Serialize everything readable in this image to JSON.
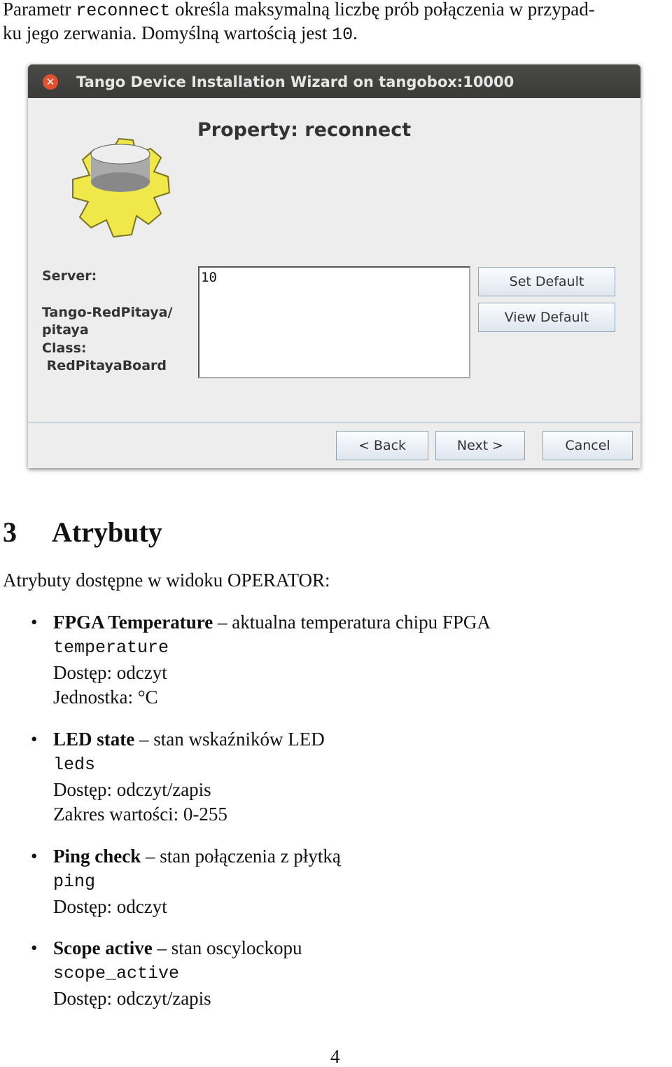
{
  "intro": {
    "line1_a": "Parametr ",
    "line1_code": "reconnect",
    "line1_b": " określa maksymalną liczbę prób połączenia w przypad-",
    "line2_a": "ku jego zerwania. Domyślną wartością jest ",
    "line2_code": "10",
    "line2_b": "."
  },
  "window": {
    "title": "Tango Device Installation Wizard on tangobox:10000",
    "property_title": "Property: reconnect",
    "server_label": "Server:",
    "server_value1": "Tango-RedPitaya/",
    "server_value2": "pitaya",
    "class_label": "Class:",
    "class_value": " RedPitayaBoard",
    "value": "10",
    "set_default": "Set Default",
    "view_default": "View Default",
    "back": "< Back",
    "next": "Next >",
    "cancel": "Cancel"
  },
  "section": {
    "number": "3",
    "title": "Atrybuty",
    "intro": "Atrybuty dostępne w widoku OPERATOR:"
  },
  "items": [
    {
      "name": "FPGA Temperature",
      "desc": " – aktualna temperatura chipu FPGA",
      "code": "temperature",
      "lines": [
        "Dostęp: odczyt",
        "Jednostka: °C"
      ]
    },
    {
      "name": "LED state",
      "desc": " – stan wskaźników LED",
      "code": "leds",
      "lines": [
        "Dostęp: odczyt/zapis",
        "Zakres wartości: 0-255"
      ]
    },
    {
      "name": "Ping check",
      "desc": " – stan połączenia z płytką",
      "code": "ping",
      "lines": [
        "Dostęp: odczyt"
      ]
    },
    {
      "name": "Scope active",
      "desc": " – stan oscylockopu",
      "code": "scope_active",
      "lines": [
        "Dostęp: odczyt/zapis"
      ]
    }
  ],
  "page_number": "4"
}
